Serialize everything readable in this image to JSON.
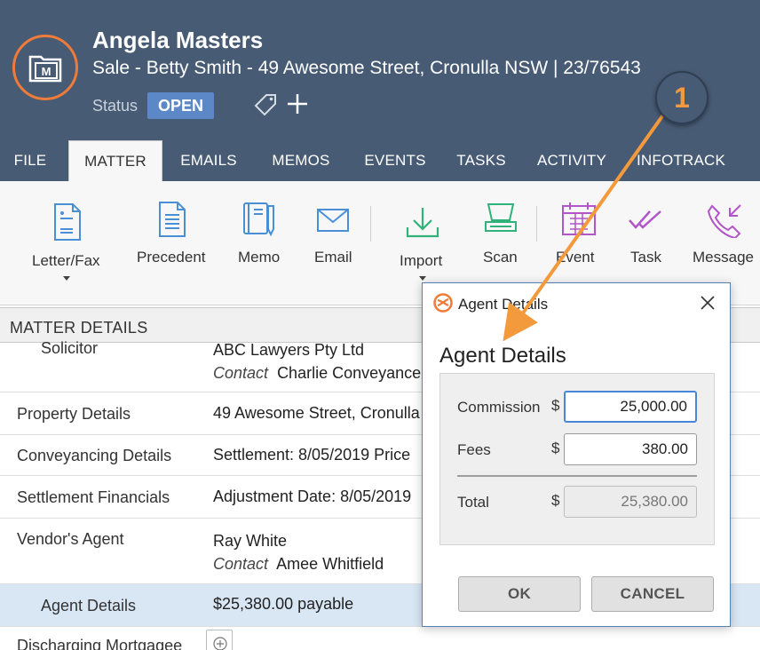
{
  "header": {
    "title": "Angela Masters",
    "subtitle": "Sale - Betty Smith - 49 Awesome Street, Cronulla NSW | 23/76543",
    "status_label": "Status",
    "status_value": "OPEN",
    "logo_letter": "M",
    "tabs": [
      {
        "label": "FILE"
      },
      {
        "label": "MATTER"
      },
      {
        "label": "EMAILS"
      },
      {
        "label": "MEMOS"
      },
      {
        "label": "EVENTS"
      },
      {
        "label": "TASKS"
      },
      {
        "label": "ACTIVITY"
      },
      {
        "label": "INFOTRACK"
      }
    ],
    "active_tab": "MATTER"
  },
  "ribbon": {
    "buttons": [
      {
        "label": "Letter/Fax",
        "icon": "letter-icon"
      },
      {
        "label": "Precedent",
        "icon": "document-icon"
      },
      {
        "label": "Memo",
        "icon": "memo-icon"
      },
      {
        "label": "Email",
        "icon": "envelope-icon"
      },
      {
        "label": "Import",
        "icon": "download-icon"
      },
      {
        "label": "Scan",
        "icon": "scanner-icon"
      },
      {
        "label": "Event",
        "icon": "calendar-icon"
      },
      {
        "label": "Task",
        "icon": "checkmark-icon"
      },
      {
        "label": "Message",
        "icon": "phone-message-icon"
      }
    ]
  },
  "details": {
    "header": "MATTER DETAILS",
    "rows": [
      {
        "label": "Solicitor",
        "value": "ABC Lawyers Pty Ltd",
        "contact_label": "Contact",
        "contact": "Charlie Conveyancer"
      },
      {
        "label": "Property Details",
        "value": "49 Awesome Street, Cronulla"
      },
      {
        "label": "Conveyancing Details",
        "value": "Settlement: 8/05/2019 Price"
      },
      {
        "label": "Settlement Financials",
        "value": "Adjustment Date: 8/05/2019"
      },
      {
        "label": "Vendor's Agent",
        "value": "Ray White",
        "contact_label": "Contact",
        "contact": "Amee Whitfield"
      },
      {
        "label": "Agent Details",
        "value": "$25,380.00 payable"
      },
      {
        "label": "Discharging Mortgagee",
        "value": ""
      }
    ]
  },
  "dialog": {
    "title": "Agent Details",
    "heading": "Agent Details",
    "currency": "$",
    "commission_label": "Commission",
    "commission_value": "25,000.00",
    "fees_label": "Fees",
    "fees_value": "380.00",
    "total_label": "Total",
    "total_value": "25,380.00",
    "ok_label": "OK",
    "cancel_label": "CANCEL"
  },
  "callout": {
    "number": "1"
  },
  "colors": {
    "header_bg": "#475b74",
    "accent_orange": "#ef7b3a",
    "status_blue": "#5d88c7",
    "icon_blue": "#4a8fd6",
    "icon_green": "#2fb37a",
    "icon_purple": "#b255c8",
    "highlight_row": "#d9e7f5"
  }
}
